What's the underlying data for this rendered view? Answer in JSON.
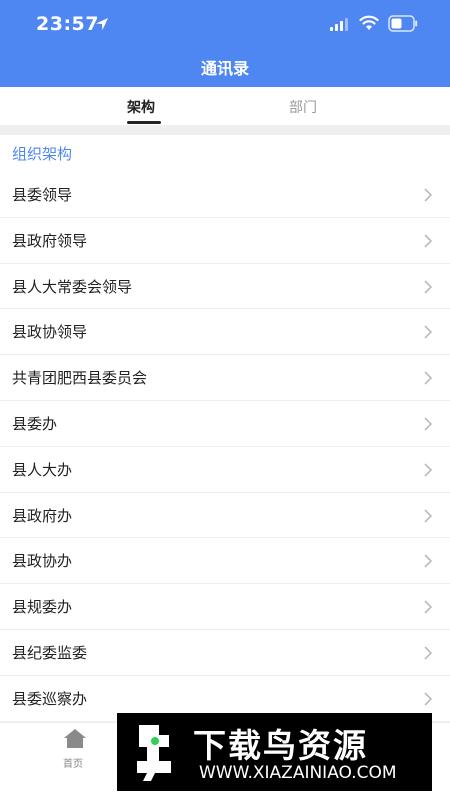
{
  "status_bar": {
    "time": "23:57"
  },
  "header": {
    "title": "通讯录"
  },
  "tabs": [
    {
      "label": "架构",
      "active": true
    },
    {
      "label": "部门",
      "active": false
    }
  ],
  "section": {
    "title": "组织架构"
  },
  "items": [
    {
      "label": "县委领导"
    },
    {
      "label": "县政府领导"
    },
    {
      "label": "县人大常委会领导"
    },
    {
      "label": "县政协领导"
    },
    {
      "label": "共青团肥西县委员会"
    },
    {
      "label": "县委办"
    },
    {
      "label": "县人大办"
    },
    {
      "label": "县政府办"
    },
    {
      "label": "县政协办"
    },
    {
      "label": "县规委办"
    },
    {
      "label": "县纪委监委"
    },
    {
      "label": "县委巡察办"
    }
  ],
  "tabbar": {
    "home_label": "首页"
  },
  "watermark": {
    "title": "下载鸟资源",
    "url": "WWW.XIAZAINIAO.COM"
  },
  "colors": {
    "accent": "#4f87f2",
    "section_bg": "#efefef"
  },
  "icons": {
    "row_arrow": "chevron-right-icon",
    "home": "home-icon"
  }
}
